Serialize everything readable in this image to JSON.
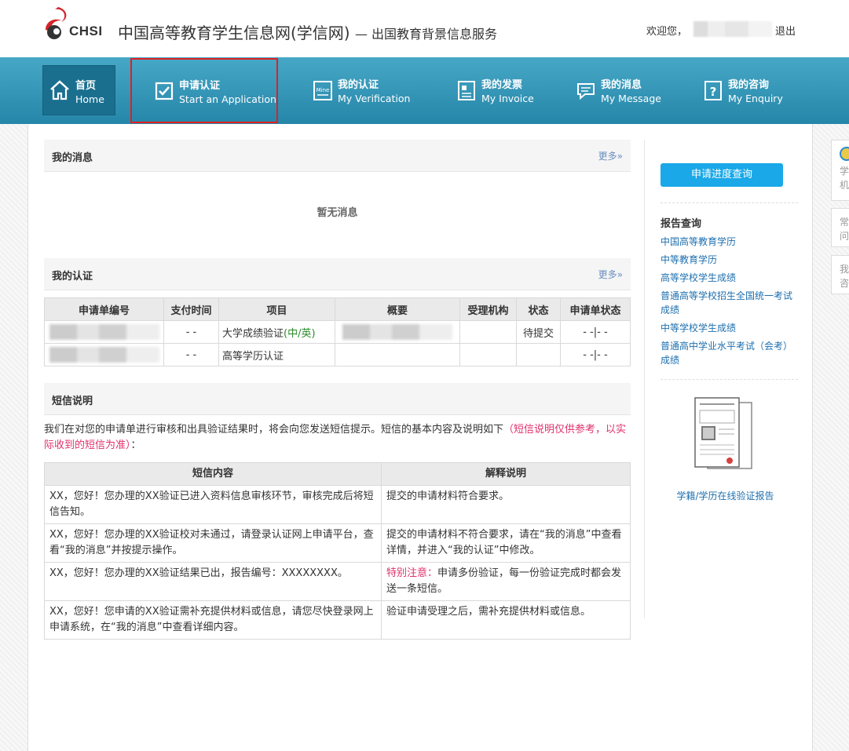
{
  "header": {
    "logo_text": "CHSI",
    "site_title": "中国高等教育学生信息网(学信网)",
    "site_subtitle": "— 出国教育背景信息服务",
    "welcome": "欢迎您，",
    "logout": "退出"
  },
  "nav": {
    "home": {
      "cn": "首页",
      "en": "Home"
    },
    "apply": {
      "cn": "申请认证",
      "en": "Start an Application"
    },
    "verification": {
      "cn": "我的认证",
      "en": "My Verification"
    },
    "invoice": {
      "cn": "我的发票",
      "en": "My Invoice"
    },
    "message": {
      "cn": "我的消息",
      "en": "My Message"
    },
    "enquiry": {
      "cn": "我的咨询",
      "en": "My Enquiry"
    }
  },
  "messages": {
    "title": "我的消息",
    "more": "更多»",
    "empty": "暂无消息"
  },
  "certs": {
    "title": "我的认证",
    "more": "更多»",
    "columns": [
      "申请单编号",
      "支付时间",
      "项目",
      "概要",
      "受理机构",
      "状态",
      "申请单状态"
    ],
    "rows": [
      {
        "pay_time": "- -",
        "item_main": "大学成绩验证",
        "item_lang": "(中/英)",
        "institution": "",
        "status": "待提交",
        "order_status": "- -|- -"
      },
      {
        "pay_time": "- -",
        "item_main": "高等学历认证",
        "item_lang": "",
        "institution": "",
        "status": "",
        "order_status": "- -|- -"
      }
    ]
  },
  "sms": {
    "title": "短信说明",
    "intro": "我们在对您的申请单进行审核和出具验证结果时，将会向您发送短信提示。短信的基本内容及说明如下",
    "intro_note": "（短信说明仅供参考，以实际收到的短信为准）",
    "intro_end": "：",
    "columns": [
      "短信内容",
      "解释说明"
    ],
    "rows": [
      {
        "content": "XX，您好！您办理的XX验证已进入资料信息审核环节，审核完成后将短信告知。",
        "note_prefix": "",
        "note": "提交的申请材料符合要求。"
      },
      {
        "content": "XX，您好！您办理的XX验证校对未通过，请登录认证网上申请平台，查看“我的消息”并按提示操作。",
        "note_prefix": "",
        "note": "提交的申请材料不符合要求，请在“我的消息”中查看详情，并进入“我的认证”中修改。"
      },
      {
        "content": "XX，您好！您办理的XX验证结果已出，报告编号：XXXXXXXX。",
        "note_prefix": "特别注意：",
        "note": "申请多份验证，每一份验证完成时都会发送一条短信。"
      },
      {
        "content": "XX，您好！您申请的XX验证需补充提供材料或信息，请您尽快登录网上申请系统，在“我的消息”中查看详细内容。",
        "note_prefix": "",
        "note": "验证申请受理之后，需补充提供材料或信息。"
      }
    ]
  },
  "sidebar": {
    "progress_button": "申请进度查询",
    "report_title": "报告查询",
    "report_links": [
      "中国高等教育学历",
      "中等教育学历",
      "高等学校学生成绩",
      "普通高等学校招生全国统一考试成绩",
      "中等学校学生成绩",
      "普通高中学业水平考试（会考）成绩"
    ],
    "online_report": "学籍/学历在线验证报告"
  },
  "float_panel": {
    "box1": "学机",
    "box2": "常问",
    "box3": "我咨"
  },
  "colors": {
    "nav_bg": "#2f91b4",
    "nav_active": "#1a6f8f",
    "highlight_border": "#e02020",
    "primary_button": "#1aa8e8",
    "link": "#1e6fae",
    "warning_text": "#e0316b"
  }
}
